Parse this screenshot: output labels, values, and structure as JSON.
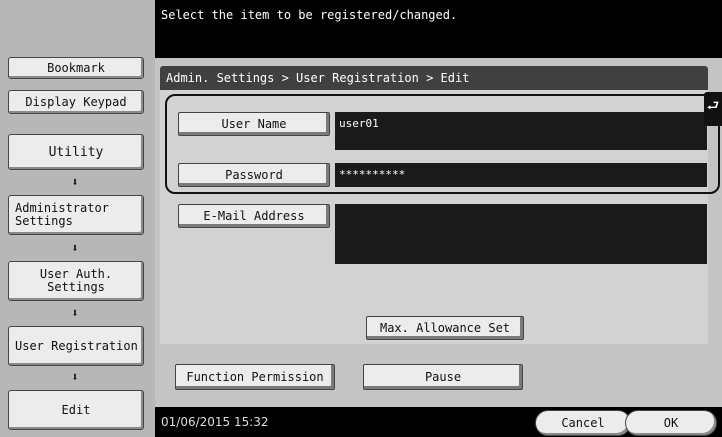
{
  "topbar": {
    "message": "Select the item to be registered/changed."
  },
  "sidebar": {
    "bookmark": "Bookmark",
    "display_keypad": "Display Keypad",
    "path": [
      "Utility",
      "Administrator Settings",
      "User Auth. Settings",
      "User Registration",
      "Edit"
    ],
    "arrow_glyph": "⬇"
  },
  "breadcrumb": "Admin. Settings > User Registration > Edit",
  "fields": {
    "user_name": {
      "label": "User Name",
      "value": "user01"
    },
    "password": {
      "label": "Password",
      "value": "**********"
    },
    "email": {
      "label": "E-Mail Address",
      "value": ""
    }
  },
  "buttons": {
    "max_allowance": "Max. Allowance Set",
    "function_permission": "Function Permission",
    "pause": "Pause",
    "cancel": "Cancel",
    "ok": "OK"
  },
  "status": {
    "datetime": "01/06/2015  15:32"
  },
  "icons": {
    "back_tab": "back-arrow-icon"
  }
}
